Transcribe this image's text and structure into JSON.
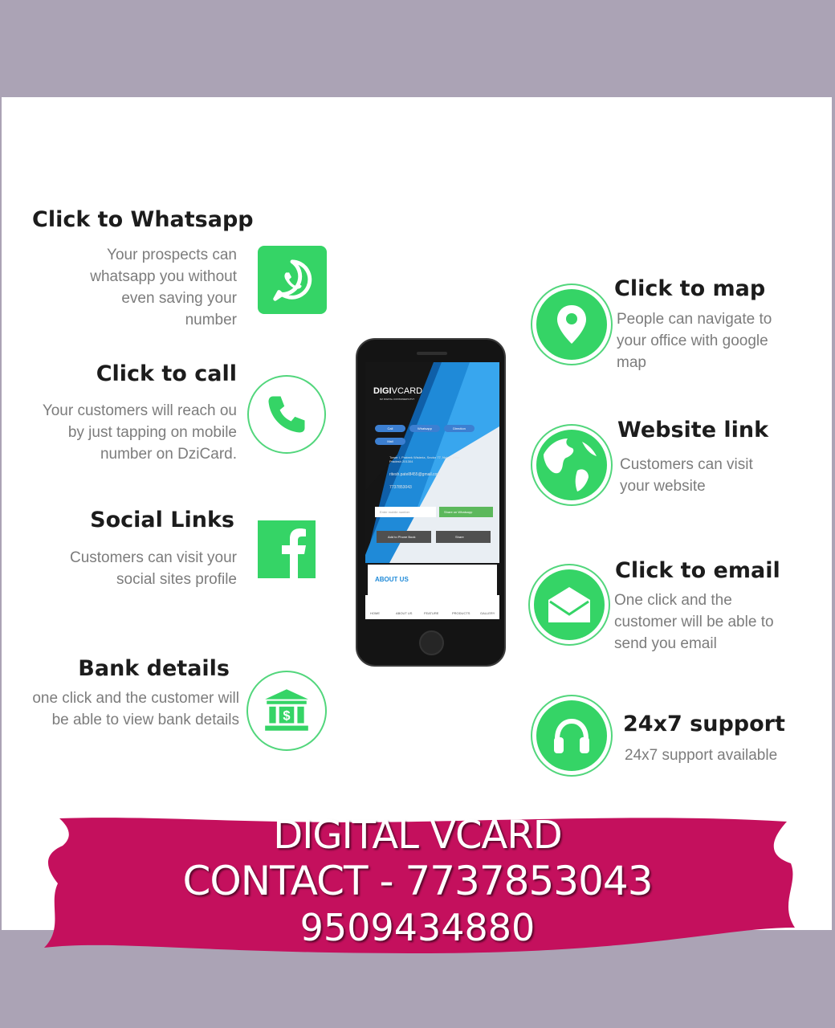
{
  "features_left": [
    {
      "title": "Click to Whatsapp",
      "desc": "Your prospects can whatsapp you without even saving  your number",
      "icon": "whatsapp-icon"
    },
    {
      "title": "Click to call",
      "desc": "Your customers will reach ou by just tapping on mobile number on DziCard.",
      "icon": "phone-icon"
    },
    {
      "title": "Social Links",
      "desc": "Customers can visit your social sites profile",
      "icon": "facebook-icon"
    },
    {
      "title": "Bank details",
      "desc": "one click and the customer will be able to view bank details",
      "icon": "bank-icon"
    }
  ],
  "features_right": [
    {
      "title": "Click to map",
      "desc": "People can navigate to your office with google map",
      "icon": "location-pin-icon"
    },
    {
      "title": "Website link",
      "desc": "Customers can visit your website",
      "icon": "globe-icon"
    },
    {
      "title": "Click to email",
      "desc": "One click and the customer will be able to send you email",
      "icon": "envelope-icon"
    },
    {
      "title": "24x7 support",
      "desc": "24x7 support available",
      "icon": "headphones-icon"
    }
  ],
  "phone": {
    "logo_bold": "DIGI",
    "logo_light": "VCARD",
    "tagline": "DZ DIGITAL CONTAINERS PVT",
    "buttons": [
      "Call",
      "Whatsapp",
      "Direction",
      "Mail"
    ],
    "address": "Tower I, Prateek Wisteria, Sector 77, Noida, Uttar Pradesh 201304",
    "email": "ritesh.patel8455@gmail.com",
    "phone": "7737853043",
    "input_placeholder": "Enter mobile number",
    "whatsapp_share": "Share on Whatsapp",
    "add_to_phonebook": "Add to Phone Book",
    "share": "Share",
    "about_us": "ABOUT US",
    "nav": [
      "HOME",
      "ABOUT US",
      "FEATURE",
      "PRODUCTS",
      "GALLERY"
    ]
  },
  "banner": {
    "line1": "DIGITAL VCARD",
    "line2": "CONTACT - 7737853043",
    "line3": "9509434880"
  },
  "colors": {
    "accent_green": "#35d466",
    "ring_green": "#52d67c",
    "banner_pink": "#c4105d",
    "frame_gray": "#aba3b5",
    "phone_blue": "#1f8ad8"
  }
}
